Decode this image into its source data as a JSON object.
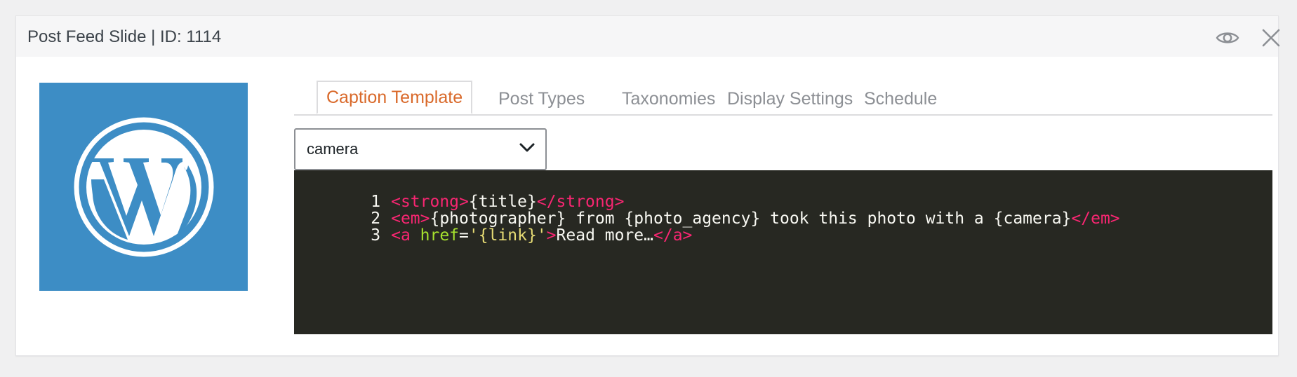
{
  "header": {
    "title": "Post Feed Slide | ID: 1114"
  },
  "icons": {
    "preview": "eye-icon",
    "close": "close-icon",
    "thumbnail": "wordpress-logo-icon",
    "dropdown": "chevron-down-icon"
  },
  "tabs": [
    {
      "label": "Caption Template",
      "active": true
    },
    {
      "label": "Post Types",
      "active": false
    },
    {
      "label": "Taxonomies",
      "active": false
    },
    {
      "label": "Display Settings",
      "active": false
    },
    {
      "label": "Schedule",
      "active": false
    }
  ],
  "template_select": {
    "value": "camera"
  },
  "editor": {
    "lines": [
      {
        "number": "1",
        "tokens": [
          {
            "type": "tag",
            "text": "<strong>"
          },
          {
            "type": "txt",
            "text": "{title}"
          },
          {
            "type": "tag",
            "text": "</strong>"
          }
        ]
      },
      {
        "number": "2",
        "tokens": [
          {
            "type": "tag",
            "text": "<em>"
          },
          {
            "type": "txt",
            "text": "{photographer} from {photo_agency} took this photo with a {camera}"
          },
          {
            "type": "tag",
            "text": "</em>"
          }
        ]
      },
      {
        "number": "3",
        "tokens": [
          {
            "type": "tag",
            "text": "<a "
          },
          {
            "type": "attr",
            "text": "href"
          },
          {
            "type": "txt",
            "text": "="
          },
          {
            "type": "str",
            "text": "'{link}'"
          },
          {
            "type": "tag",
            "text": ">"
          },
          {
            "type": "txt",
            "text": "Read more…"
          },
          {
            "type": "tag",
            "text": "</a>"
          }
        ]
      }
    ]
  },
  "colors": {
    "accent": "#d9692a",
    "thumbnail_bg": "#3d8dc5",
    "editor_bg": "#272822",
    "tag": "#f92672",
    "attr": "#a6e22e",
    "string": "#e6db74"
  }
}
